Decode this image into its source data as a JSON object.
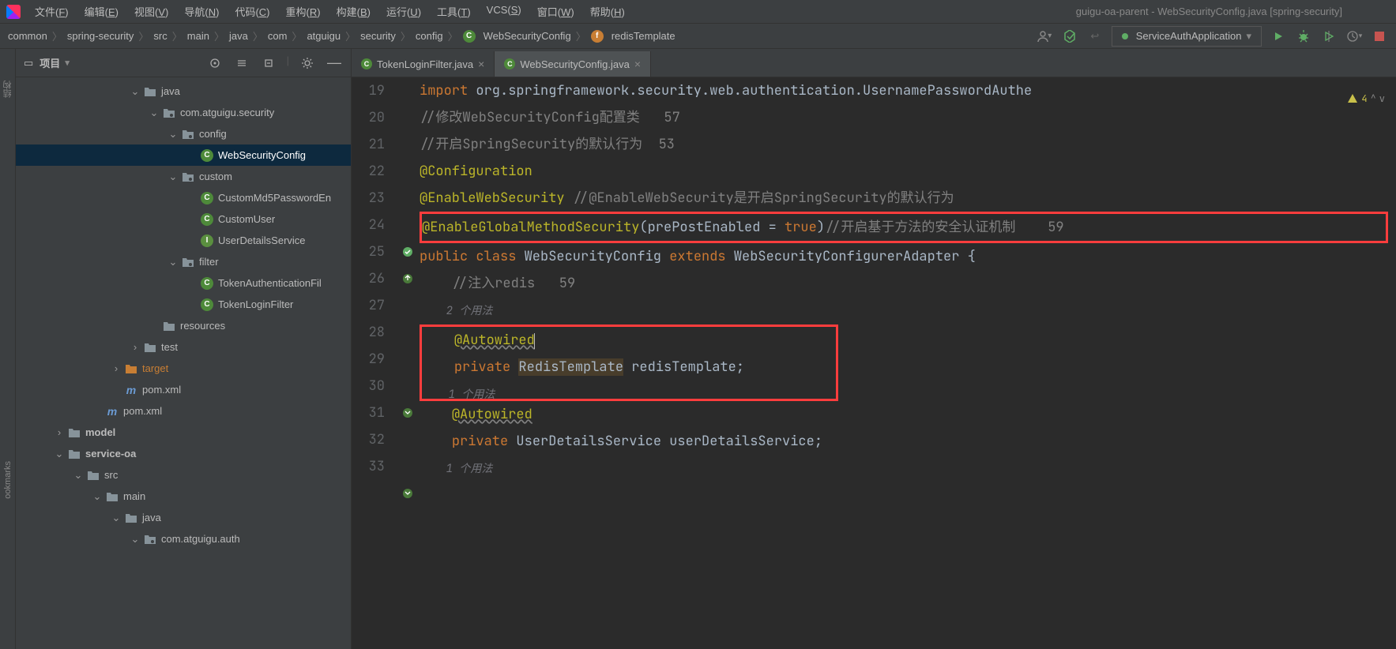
{
  "window": {
    "title": "guigu-oa-parent - WebSecurityConfig.java [spring-security]"
  },
  "menus": [
    {
      "label": "文件",
      "key": "F"
    },
    {
      "label": "编辑",
      "key": "E"
    },
    {
      "label": "视图",
      "key": "V"
    },
    {
      "label": "导航",
      "key": "N"
    },
    {
      "label": "代码",
      "key": "C"
    },
    {
      "label": "重构",
      "key": "R"
    },
    {
      "label": "构建",
      "key": "B"
    },
    {
      "label": "运行",
      "key": "U"
    },
    {
      "label": "工具",
      "key": "T"
    },
    {
      "label": "VCS",
      "key": "S"
    },
    {
      "label": "窗口",
      "key": "W"
    },
    {
      "label": "帮助",
      "key": "H"
    }
  ],
  "breadcrumb": [
    "common",
    "spring-security",
    "src",
    "main",
    "java",
    "com",
    "atguigu",
    "security",
    "config"
  ],
  "breadcrumb_class": {
    "name": "WebSecurityConfig",
    "field": "redisTemplate",
    "icon_class": "C",
    "icon_field": "f"
  },
  "run_config": "ServiceAuthApplication",
  "panel": {
    "title": "项目"
  },
  "tree": [
    {
      "indent": 6,
      "chev": "v",
      "icon": "folder",
      "label": "java",
      "orange": false
    },
    {
      "indent": 7,
      "chev": "v",
      "icon": "package",
      "label": "com.atguigu.security"
    },
    {
      "indent": 8,
      "chev": "v",
      "icon": "package",
      "label": "config"
    },
    {
      "indent": 9,
      "chev": "",
      "icon": "class",
      "label": "WebSecurityConfig",
      "sel": true
    },
    {
      "indent": 8,
      "chev": "v",
      "icon": "package",
      "label": "custom"
    },
    {
      "indent": 9,
      "chev": "",
      "icon": "class",
      "label": "CustomMd5PasswordEn"
    },
    {
      "indent": 9,
      "chev": "",
      "icon": "class",
      "label": "CustomUser"
    },
    {
      "indent": 9,
      "chev": "",
      "icon": "iface",
      "label": "UserDetailsService"
    },
    {
      "indent": 8,
      "chev": "v",
      "icon": "package",
      "label": "filter"
    },
    {
      "indent": 9,
      "chev": "",
      "icon": "class",
      "label": "TokenAuthenticationFil"
    },
    {
      "indent": 9,
      "chev": "",
      "icon": "class",
      "label": "TokenLoginFilter"
    },
    {
      "indent": 7,
      "chev": "",
      "icon": "folder",
      "label": "resources"
    },
    {
      "indent": 6,
      "chev": ">",
      "icon": "folder",
      "label": "test"
    },
    {
      "indent": 5,
      "chev": ">",
      "icon": "folder",
      "label": "target",
      "orange": true
    },
    {
      "indent": 5,
      "chev": "",
      "icon": "mvn",
      "label": "pom.xml"
    },
    {
      "indent": 4,
      "chev": "",
      "icon": "mvn",
      "label": "pom.xml"
    },
    {
      "indent": 2,
      "chev": ">",
      "icon": "folder",
      "label": "model",
      "bold": true
    },
    {
      "indent": 2,
      "chev": "v",
      "icon": "folder",
      "label": "service-oa",
      "bold": true
    },
    {
      "indent": 3,
      "chev": "v",
      "icon": "folder",
      "label": "src"
    },
    {
      "indent": 4,
      "chev": "v",
      "icon": "folder",
      "label": "main"
    },
    {
      "indent": 5,
      "chev": "v",
      "icon": "folder",
      "label": "java"
    },
    {
      "indent": 6,
      "chev": "v",
      "icon": "package",
      "label": "com.atguigu.auth"
    }
  ],
  "tabs": [
    {
      "label": "TokenLoginFilter.java",
      "active": false
    },
    {
      "label": "WebSecurityConfig.java",
      "active": true
    }
  ],
  "problems": {
    "warnings": 4
  },
  "editor": {
    "lines": [
      {
        "num": 19,
        "frag": [
          {
            "t": "import ",
            "c": "kw"
          },
          {
            "t": "org.springframework.security.web.authentication.UsernamePasswordAuthe",
            "c": "ty"
          }
        ]
      },
      {
        "num": 20,
        "frag": []
      },
      {
        "num": 21,
        "frag": [
          {
            "t": "//修改WebSecurityConfig配置类   57",
            "c": "cm"
          }
        ]
      },
      {
        "num": 22,
        "frag": [
          {
            "t": "//开启SpringSecurity的默认行为  53",
            "c": "cm"
          }
        ]
      },
      {
        "num": 23,
        "frag": [
          {
            "t": "@Configuration",
            "c": "an"
          }
        ]
      },
      {
        "num": 24,
        "frag": [
          {
            "t": "@EnableWebSecurity",
            "c": "an"
          },
          {
            "t": " //@EnableWebSecurity是开启SpringSecurity的默认行为",
            "c": "cm"
          }
        ]
      },
      {
        "num": 25,
        "red": true,
        "frag": [
          {
            "t": "@EnableGlobalMethodSecurity",
            "c": "an"
          },
          {
            "t": "(prePostEnabled = ",
            "c": "ty"
          },
          {
            "t": "true",
            "c": "kw"
          },
          {
            "t": ")",
            "c": "ty"
          },
          {
            "t": "//开启基于方法的安全认证机制    59",
            "c": "cm"
          }
        ]
      },
      {
        "num": 26,
        "icon": "override",
        "frag": [
          {
            "t": "public class ",
            "c": "kw"
          },
          {
            "t": "WebSecurityConfig ",
            "c": "ty"
          },
          {
            "t": "extends ",
            "c": "kw"
          },
          {
            "t": "WebSecurityConfigurerAdapter {",
            "c": "ty"
          }
        ]
      },
      {
        "num": 27,
        "frag": []
      },
      {
        "num": 28,
        "indent": 1,
        "frag": [
          {
            "t": "//注入redis   59",
            "c": "cm"
          }
        ]
      },
      {
        "usage": true,
        "indent": 1,
        "text": "2 个用法"
      },
      {
        "num": 29,
        "indent": 1,
        "red2": "top",
        "frag": [
          {
            "t": "@Autowired",
            "c": "an",
            "wavy": true,
            "caret": true
          }
        ]
      },
      {
        "num": 30,
        "indent": 1,
        "icon": "nav",
        "red2": "mid",
        "frag": [
          {
            "t": "private ",
            "c": "kw"
          },
          {
            "t": "RedisTemplate",
            "c": "ty",
            "hl": true
          },
          {
            "t": " redisTemplate;",
            "c": "ty"
          }
        ]
      },
      {
        "usage": true,
        "indent": 1,
        "red2": "bot",
        "text": "1 个用法"
      },
      {
        "num": 31,
        "indent": 1,
        "frag": [
          {
            "t": "@Autowired",
            "c": "an",
            "wavy": true
          }
        ]
      },
      {
        "num": 32,
        "indent": 1,
        "icon": "nav",
        "frag": [
          {
            "t": "private ",
            "c": "kw"
          },
          {
            "t": "UserDetailsService userDetailsService;",
            "c": "ty"
          }
        ]
      },
      {
        "num": 33,
        "frag": []
      },
      {
        "usage": true,
        "indent": 1,
        "text": "1 个用法"
      }
    ]
  },
  "rail": {
    "structure": "结构",
    "bookmarks": "ookmarks"
  }
}
